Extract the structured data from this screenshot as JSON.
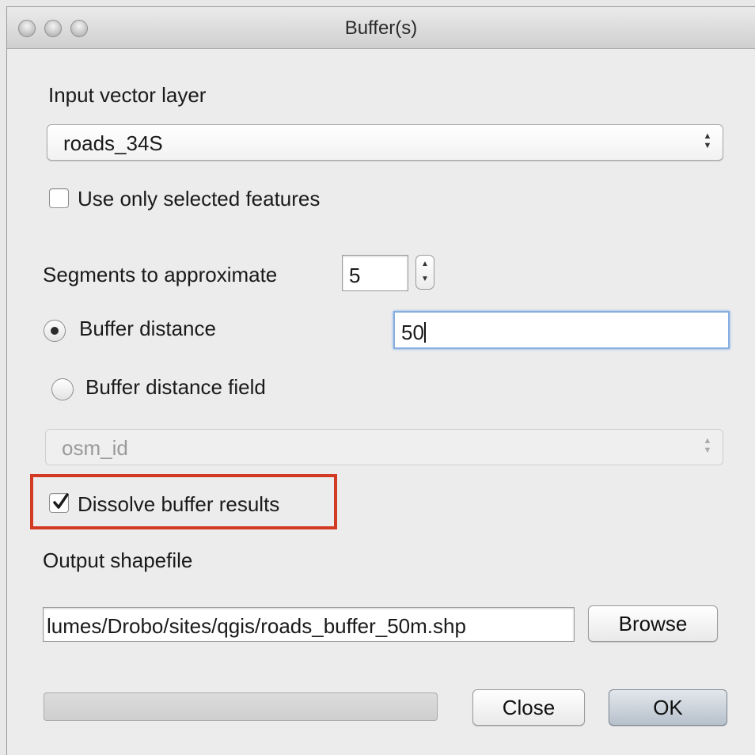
{
  "window": {
    "title": "Buffer(s)"
  },
  "input_layer": {
    "label": "Input vector layer",
    "selected": "roads_34S"
  },
  "use_selected": {
    "label": "Use only selected features",
    "checked": false
  },
  "segments": {
    "label": "Segments to approximate",
    "value": "5"
  },
  "buffer_distance": {
    "label": "Buffer distance",
    "value": "50",
    "selected": true
  },
  "buffer_field": {
    "label": "Buffer distance field",
    "selected": false,
    "field_value": "osm_id"
  },
  "dissolve": {
    "label": "Dissolve buffer results",
    "checked": true
  },
  "output": {
    "label": "Output shapefile",
    "path": "lumes/Drobo/sites/qgis/roads_buffer_50m.shp",
    "browse_label": "Browse"
  },
  "footer": {
    "close_label": "Close",
    "ok_label": "OK",
    "progress": 0
  },
  "colors": {
    "highlight": "#d33a24",
    "focus_ring": "#86aee0"
  }
}
